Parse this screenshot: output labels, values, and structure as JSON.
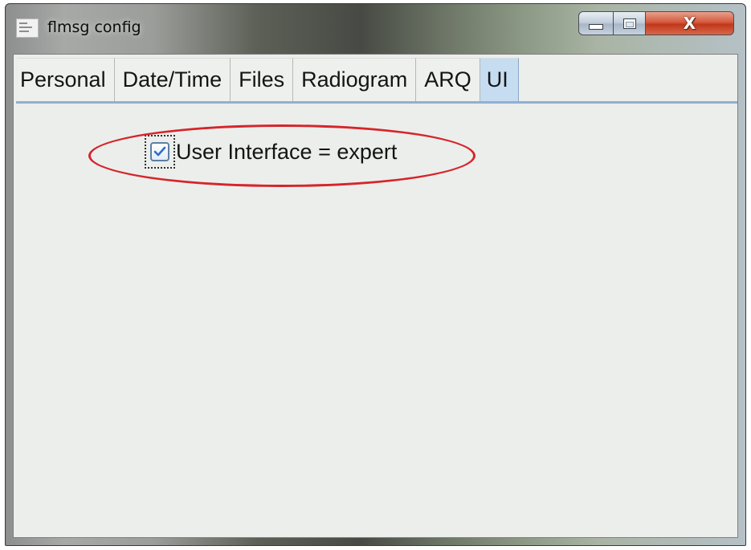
{
  "window": {
    "title": "flmsg config",
    "app_icon": "flmsg-app-icon",
    "controls": {
      "minimize_icon": "minimize-icon",
      "maximize_icon": "maximize-icon",
      "close_label": "X"
    }
  },
  "tabs": [
    {
      "label": "Personal",
      "active": false
    },
    {
      "label": "Date/Time",
      "active": false
    },
    {
      "label": "Files",
      "active": false
    },
    {
      "label": "Radiogram",
      "active": false
    },
    {
      "label": "ARQ",
      "active": false
    },
    {
      "label": "UI",
      "active": true
    }
  ],
  "ui_panel": {
    "expert_checkbox": {
      "label": "User Interface = expert",
      "checked": true,
      "icon": "check-icon"
    },
    "highlight": "red-ellipse-annotation"
  },
  "colors": {
    "active_tab": "#c6dcf0",
    "tab_underline": "#8fb0d2",
    "annotation_red": "#d6252a",
    "close_button": "#c0381b",
    "check_blue": "#2a6fd0"
  }
}
